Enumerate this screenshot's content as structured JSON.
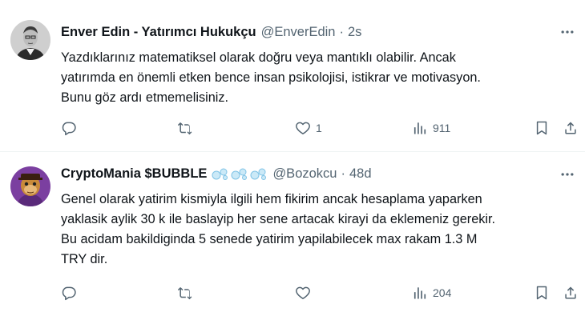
{
  "tweets": [
    {
      "display_name": "Enver Edin - Yatırımcı Hukukçu",
      "handle": "@EnverEdin",
      "separator": "·",
      "time": "2s",
      "text_lines": [
        "Yazdıklarınız matematiksel olarak doğru veya mantıklı olabilir. Ancak",
        "yatırımda en önemli etken bence insan psikolojisi, istikrar ve motivasyon.",
        "Bunu göz ardı etmemelisiniz."
      ],
      "avatar_icon": "man-portrait-avatar",
      "actions": {
        "reply_count": "",
        "retweet_count": "",
        "like_count": "1",
        "views_count": "911"
      }
    },
    {
      "display_name": "CryptoMania $BUBBLE",
      "handle": "@Bozokcu",
      "separator": "·",
      "time": "48d",
      "text_lines": [
        "Genel olarak yatirim kismiyla ilgili hem fikirim ancak hesaplama yaparken",
        "yaklasik aylik 30 k ile baslayip her sene artacak kirayi da eklemeniz gerekir.",
        "Bu acidam bakildiginda 5 senede yatirim yapilabilecek max rakam 1.3 M",
        "TRY dir."
      ],
      "avatar_icon": "ape-nft-avatar",
      "name_emoji": "bubbles-emoji",
      "actions": {
        "reply_count": "",
        "retweet_count": "",
        "like_count": "",
        "views_count": "204"
      }
    }
  ],
  "colors": {
    "text": "#0f1419",
    "secondary": "#536471",
    "divider": "#eff3f4",
    "bubble": "#a8d8f0"
  }
}
